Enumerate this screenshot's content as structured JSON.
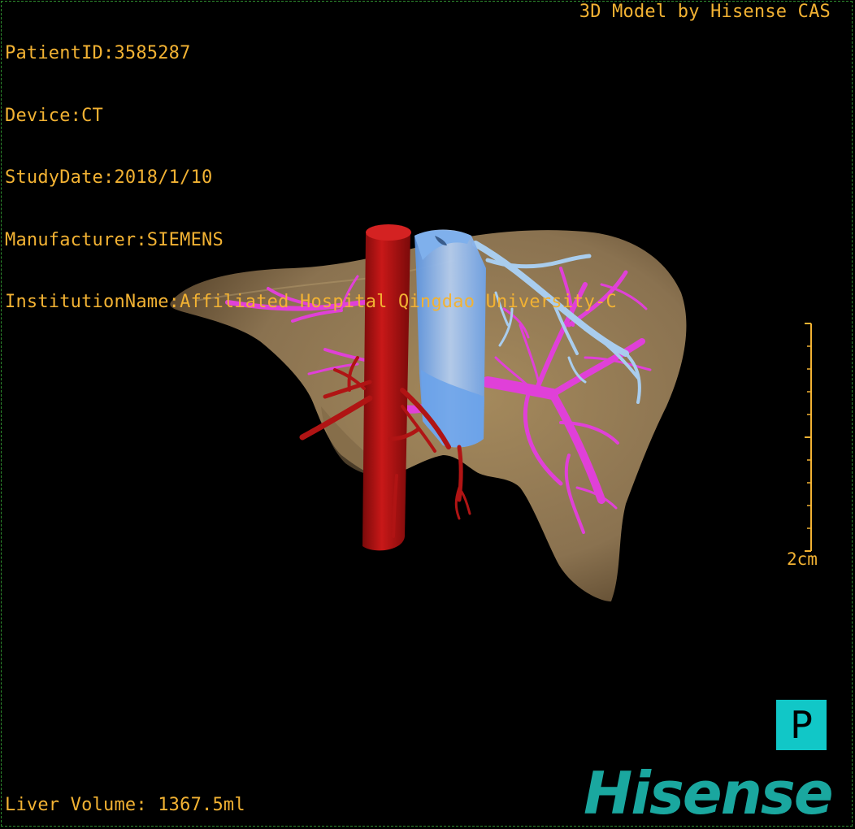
{
  "info": {
    "patient_id": "PatientID:3585287",
    "device": "Device:CT",
    "study_date": "StudyDate:2018/1/10",
    "manufacturer": "Manufacturer:SIEMENS",
    "institution": "InstitutionName:Affiliated Hospital Qingdao University-C"
  },
  "credit": "3D Model by Hisense CAS",
  "liver_volume": "Liver Volume: 1367.5ml",
  "scale_label": "2cm",
  "view_button": "P",
  "logo": "Hisense",
  "colors": {
    "overlay_text": "#f2b233",
    "liver": "#8c7550",
    "artery": "#b01414",
    "portal_vein": "#e040d8",
    "hepatic_vein": "#9fc8ec",
    "ivc": "#6fa8ee",
    "button": "#11c7c7",
    "logo": "#1aa79f"
  },
  "structures": [
    "liver",
    "aorta",
    "inferior-vena-cava",
    "portal-vein",
    "hepatic-vein",
    "hepatic-artery"
  ]
}
